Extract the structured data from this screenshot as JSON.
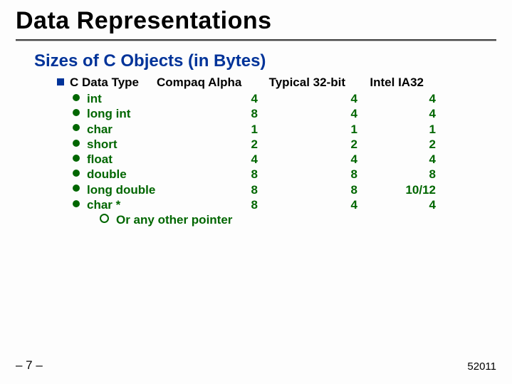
{
  "title": "Data Representations",
  "subtitle": "Sizes of C Objects (in Bytes)",
  "headers": {
    "type": "C Data Type",
    "alpha": "Compaq Alpha",
    "typ32": "Typical 32-bit",
    "ia32": "Intel IA32"
  },
  "rows": [
    {
      "type": "int",
      "alpha": "4",
      "typ32": "4",
      "ia32": "4"
    },
    {
      "type": "long int",
      "alpha": "8",
      "typ32": "4",
      "ia32": "4"
    },
    {
      "type": "char",
      "alpha": "1",
      "typ32": "1",
      "ia32": "1"
    },
    {
      "type": "short",
      "alpha": "2",
      "typ32": "2",
      "ia32": "2"
    },
    {
      "type": "float",
      "alpha": "4",
      "typ32": "4",
      "ia32": "4"
    },
    {
      "type": "double",
      "alpha": "8",
      "typ32": "8",
      "ia32": "8"
    },
    {
      "type": "long double",
      "alpha": "8",
      "typ32": "8",
      "ia32": "10/12"
    },
    {
      "type": "char *",
      "alpha": "8",
      "typ32": "4",
      "ia32": "4"
    }
  ],
  "subnote": "Or any other pointer",
  "footer": {
    "left": "– 7 –",
    "right": "52011"
  },
  "chart_data": {
    "type": "table",
    "title": "Sizes of C Objects (in Bytes)",
    "columns": [
      "C Data Type",
      "Compaq Alpha",
      "Typical 32-bit",
      "Intel IA32"
    ],
    "rows": [
      [
        "int",
        4,
        4,
        4
      ],
      [
        "long int",
        8,
        4,
        4
      ],
      [
        "char",
        1,
        1,
        1
      ],
      [
        "short",
        2,
        2,
        2
      ],
      [
        "float",
        4,
        4,
        4
      ],
      [
        "double",
        8,
        8,
        8
      ],
      [
        "long double",
        8,
        8,
        "10/12"
      ],
      [
        "char *",
        8,
        4,
        4
      ]
    ],
    "note": "char * – Or any other pointer"
  }
}
